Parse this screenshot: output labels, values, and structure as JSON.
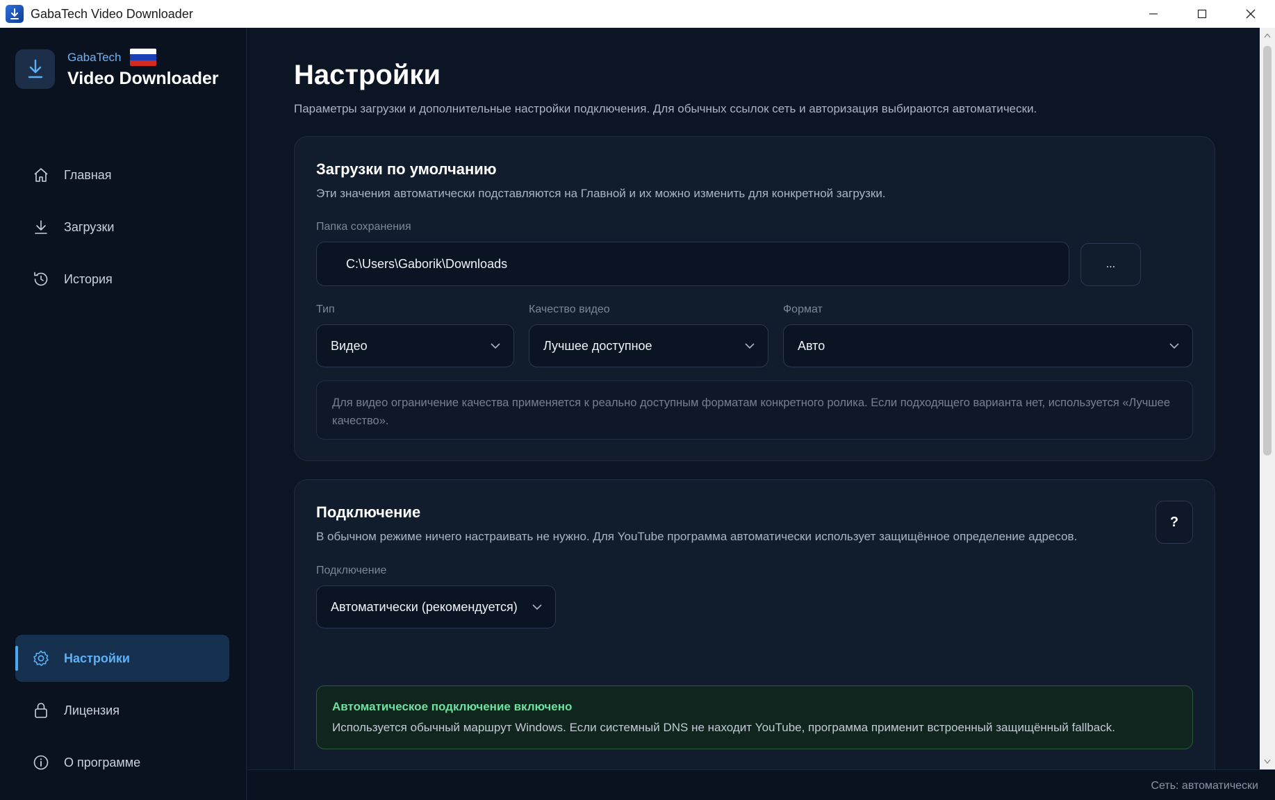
{
  "window": {
    "title": "GabaTech Video Downloader",
    "controls": [
      "minimize",
      "maximize",
      "close"
    ]
  },
  "brand": {
    "company": "GabaTech",
    "product": "Video Downloader",
    "flag": "russia"
  },
  "nav": {
    "home": "Главная",
    "downloads": "Загрузки",
    "history": "История",
    "settings": "Настройки",
    "license": "Лицензия",
    "about": "О программе",
    "active": "settings"
  },
  "page": {
    "title": "Настройки",
    "subtitle": "Параметры загрузки и дополнительные настройки подключения. Для обычных ссылок сеть и авторизация выбираются автоматически."
  },
  "defaults_card": {
    "title": "Загрузки по умолчанию",
    "desc": "Эти значения автоматически подставляются на Главной и их можно изменить для конкретной загрузки.",
    "folder_label": "Папка сохранения",
    "folder_value": "C:\\Users\\Gaborik\\Downloads",
    "browse_label": "...",
    "type_label": "Тип",
    "type_value": "Видео",
    "quality_label": "Качество видео",
    "quality_value": "Лучшее доступное",
    "format_label": "Формат",
    "format_value": "Авто",
    "note": "Для видео ограничение качества применяется к реально доступным форматам конкретного ролика. Если подходящего варианта нет, используется «Лучшее качество»."
  },
  "connection_card": {
    "title": "Подключение",
    "desc": "В обычном режиме ничего настраивать не нужно. Для YouTube программа автоматически использует защищённое определение адресов.",
    "help_label": "?",
    "conn_label": "Подключение",
    "conn_value": "Автоматически (рекомендуется)",
    "status_title": "Автоматическое подключение включено",
    "status_text": "Используется обычный маршрут Windows. Если системный DNS не находит YouTube, программа применит встроенный защищённый fallback."
  },
  "statusbar": {
    "network": "Сеть: автоматически"
  },
  "colors": {
    "background": "#0c1524",
    "sidebar": "#0a1220",
    "card": "#111c2d",
    "accent": "#4aa8f0",
    "success": "#6ee0a0"
  }
}
